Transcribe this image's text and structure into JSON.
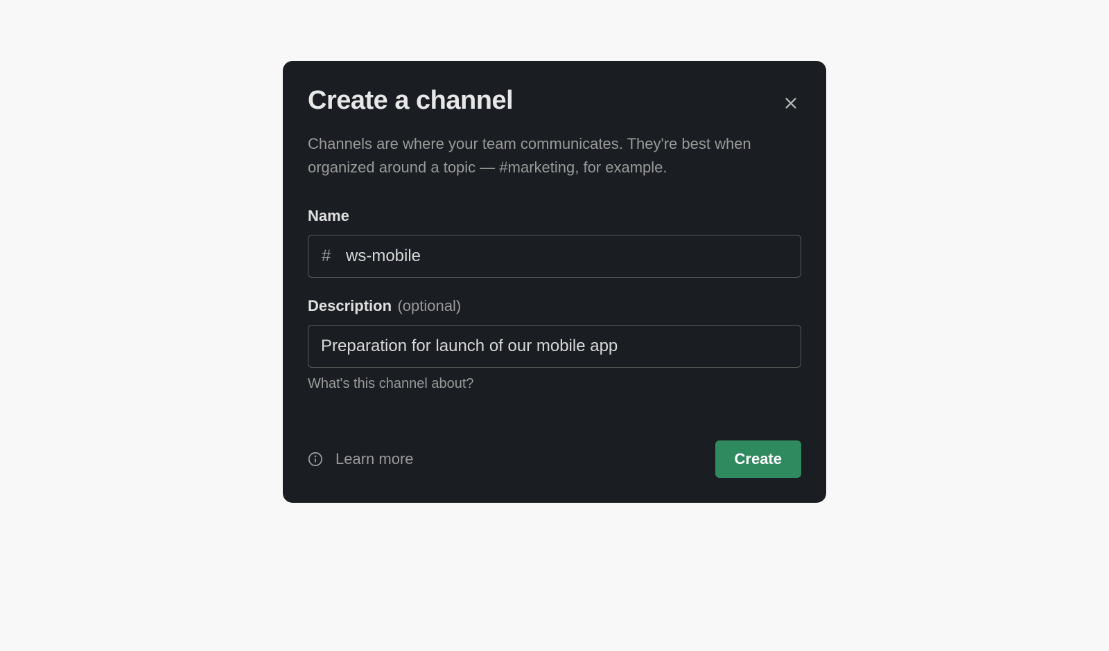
{
  "modal": {
    "title": "Create a channel",
    "description": "Channels are where your team communicates. They're best when organized around a topic — #marketing, for example.",
    "name_field": {
      "label": "Name",
      "prefix": "#",
      "value": "ws-mobile"
    },
    "description_field": {
      "label": "Description",
      "optional_text": "(optional)",
      "value": "Preparation for launch of our mobile app",
      "helper": "What's this channel about?"
    },
    "footer": {
      "learn_more": "Learn more",
      "create_button": "Create"
    }
  }
}
